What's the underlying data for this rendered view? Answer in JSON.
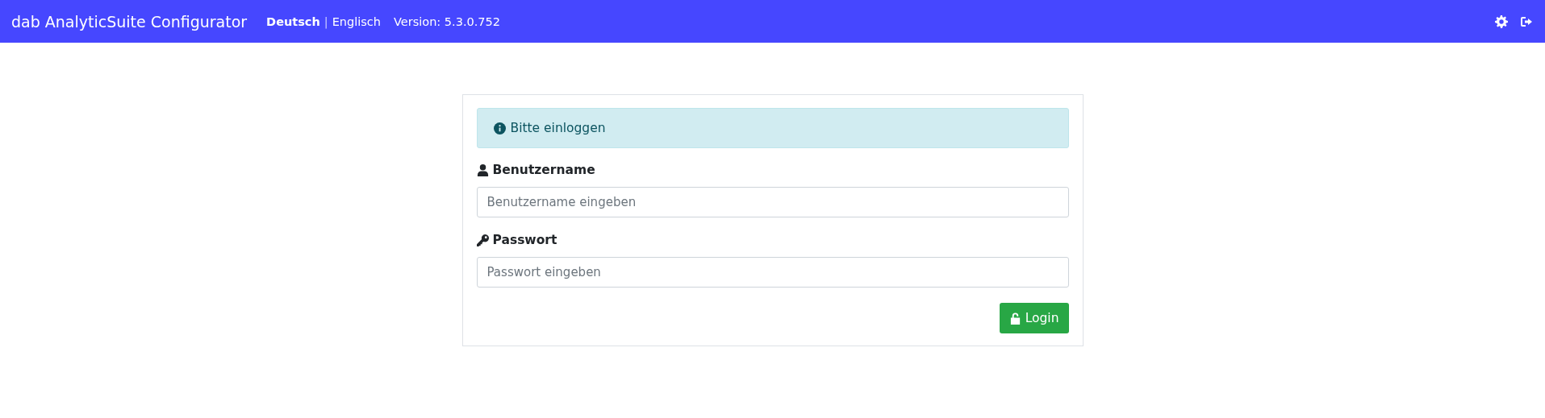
{
  "navbar": {
    "brand": "dab AnalyticSuite Configurator",
    "languages": [
      {
        "label": "Deutsch",
        "selected": true
      },
      {
        "label": "Englisch",
        "selected": false
      }
    ],
    "separator": "|",
    "version": "Version: 5.3.0.752"
  },
  "login": {
    "alert": "Bitte einloggen",
    "fields": [
      {
        "kind": "user",
        "label": "Benutzername",
        "placeholder": "Benutzername eingeben"
      },
      {
        "kind": "password",
        "label": "Passwort",
        "placeholder": "Passwort eingeben"
      }
    ],
    "button": "Login"
  }
}
